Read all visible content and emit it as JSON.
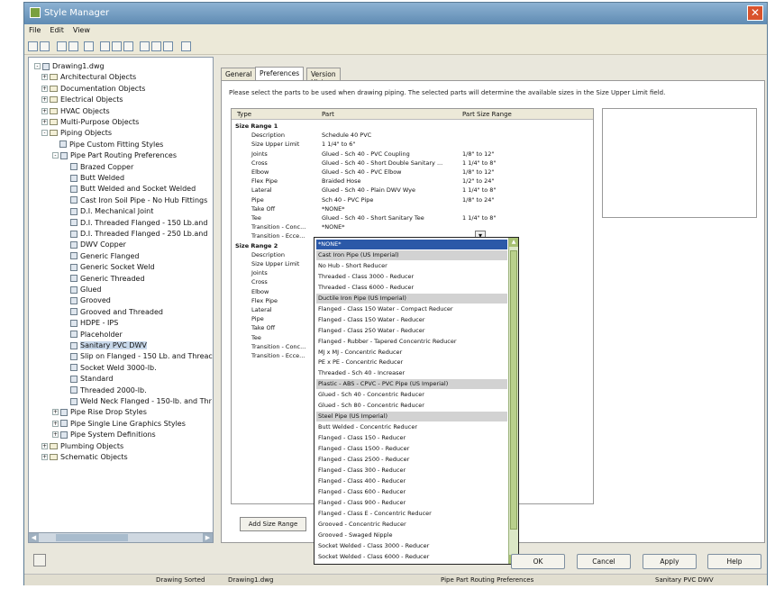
{
  "window": {
    "title": "Style Manager"
  },
  "menu": [
    "File",
    "Edit",
    "View"
  ],
  "tree": [
    {
      "label": "Drawing1.dwg",
      "x": 6,
      "icon": "drawing-icon",
      "ex": "-"
    },
    {
      "label": "Architectural Objects",
      "x": 14,
      "icon": "folder-icon",
      "ex": "+"
    },
    {
      "label": "Documentation Objects",
      "x": 14,
      "icon": "folder-icon",
      "ex": "+"
    },
    {
      "label": "Electrical Objects",
      "x": 14,
      "icon": "folder-icon",
      "ex": "+"
    },
    {
      "label": "HVAC Objects",
      "x": 14,
      "icon": "folder-icon",
      "ex": "+"
    },
    {
      "label": "Multi-Purpose Objects",
      "x": 14,
      "icon": "folder-icon",
      "ex": "+"
    },
    {
      "label": "Piping Objects",
      "x": 14,
      "icon": "folder-icon",
      "ex": "-"
    },
    {
      "label": "Pipe Custom Fitting Styles",
      "x": 34,
      "icon": "style-icon"
    },
    {
      "label": "Pipe Part Routing Preferences",
      "x": 26,
      "icon": "style-icon",
      "ex": "-"
    },
    {
      "label": "Brazed Copper",
      "x": 46,
      "icon": "style-icon"
    },
    {
      "label": "Butt Welded",
      "x": 46,
      "icon": "style-icon"
    },
    {
      "label": "Butt Welded and Socket Welded",
      "x": 46,
      "icon": "style-icon"
    },
    {
      "label": "Cast Iron Soil Pipe - No Hub Fittings",
      "x": 46,
      "icon": "style-icon"
    },
    {
      "label": "D.I. Mechanical Joint",
      "x": 46,
      "icon": "style-icon"
    },
    {
      "label": "D.I. Threaded Flanged - 150 Lb.and",
      "x": 46,
      "icon": "style-icon"
    },
    {
      "label": "D.I. Threaded Flanged - 250 Lb.and",
      "x": 46,
      "icon": "style-icon"
    },
    {
      "label": "DWV Copper",
      "x": 46,
      "icon": "style-icon"
    },
    {
      "label": "Generic Flanged",
      "x": 46,
      "icon": "style-icon"
    },
    {
      "label": "Generic Socket Weld",
      "x": 46,
      "icon": "style-icon"
    },
    {
      "label": "Generic Threaded",
      "x": 46,
      "icon": "style-icon"
    },
    {
      "label": "Glued",
      "x": 46,
      "icon": "style-icon"
    },
    {
      "label": "Grooved",
      "x": 46,
      "icon": "style-icon"
    },
    {
      "label": "Grooved and Threaded",
      "x": 46,
      "icon": "style-icon"
    },
    {
      "label": "HDPE - IPS",
      "x": 46,
      "icon": "style-icon"
    },
    {
      "label": "Placeholder",
      "x": 46,
      "icon": "style-icon"
    },
    {
      "label": "Sanitary PVC DWV",
      "x": 46,
      "icon": "style-icon",
      "sel": true
    },
    {
      "label": "Slip on Flanged - 150 Lb. and Threac",
      "x": 46,
      "icon": "style-icon"
    },
    {
      "label": "Socket Weld 3000-lb.",
      "x": 46,
      "icon": "style-icon"
    },
    {
      "label": "Standard",
      "x": 46,
      "icon": "style-icon"
    },
    {
      "label": "Threaded 2000-lb.",
      "x": 46,
      "icon": "style-icon"
    },
    {
      "label": "Weld Neck Flanged - 150-lb. and Thr",
      "x": 46,
      "icon": "style-icon"
    },
    {
      "label": "Pipe Rise Drop Styles",
      "x": 26,
      "icon": "style-icon",
      "ex": "+"
    },
    {
      "label": "Pipe Single Line Graphics Styles",
      "x": 26,
      "icon": "style-icon",
      "ex": "+"
    },
    {
      "label": "Pipe System Definitions",
      "x": 26,
      "icon": "style-icon",
      "ex": "+"
    },
    {
      "label": "Plumbing Objects",
      "x": 14,
      "icon": "folder-icon",
      "ex": "+"
    },
    {
      "label": "Schematic Objects",
      "x": 14,
      "icon": "folder-icon",
      "ex": "+"
    }
  ],
  "tabs": [
    "General",
    "Preferences",
    "Version History"
  ],
  "hint": "Please select the parts to be used when drawing piping. The selected parts will determine the available sizes in the Size Upper Limit field.",
  "grid_headers": [
    "Type",
    "Part",
    "Part Size Range"
  ],
  "grid_rows": [
    {
      "type": "Size Range 1",
      "part": "",
      "range": "",
      "group": true
    },
    {
      "type": "Description",
      "part": "Schedule 40 PVC",
      "range": ""
    },
    {
      "type": "Size Upper Limit",
      "part": "1 1/4\" to 6\"",
      "range": ""
    },
    {
      "type": "Joints",
      "part": "Glued - Sch 40 - PVC Coupling",
      "range": "1/8\" to 12\""
    },
    {
      "type": "Cross",
      "part": "Glued - Sch 40 - Short Double Sanitary ...",
      "range": "1 1/4\" to 8\""
    },
    {
      "type": "Elbow",
      "part": "Glued - Sch 40 - PVC Elbow",
      "range": "1/8\" to 12\""
    },
    {
      "type": "Flex Pipe",
      "part": "Braided Hose",
      "range": "1/2\" to 24\""
    },
    {
      "type": "Lateral",
      "part": "Glued - Sch 40 - Plain DWV Wye",
      "range": "1 1/4\" to 8\""
    },
    {
      "type": "Pipe",
      "part": "Sch 40 - PVC Pipe",
      "range": "1/8\" to 24\""
    },
    {
      "type": "Take Off",
      "part": "*NONE*",
      "range": ""
    },
    {
      "type": "Tee",
      "part": "Glued - Sch 40 - Short Sanitary Tee",
      "range": "1 1/4\" to 8\""
    },
    {
      "type": "Transition - Conc...",
      "part": "*NONE*",
      "range": ""
    },
    {
      "type": "Transition - Ecce...",
      "part": "",
      "range": ""
    },
    {
      "type": "Size Range 2",
      "part": "",
      "range": "",
      "group": true
    },
    {
      "type": "Description",
      "part": "",
      "range": ""
    },
    {
      "type": "Size Upper Limit",
      "part": "",
      "range": ""
    },
    {
      "type": "Joints",
      "part": "",
      "range": ""
    },
    {
      "type": "Cross",
      "part": "",
      "range": ""
    },
    {
      "type": "Elbow",
      "part": "",
      "range": ""
    },
    {
      "type": "Flex Pipe",
      "part": "",
      "range": ""
    },
    {
      "type": "Lateral",
      "part": "",
      "range": ""
    },
    {
      "type": "Pipe",
      "part": "",
      "range": ""
    },
    {
      "type": "Take Off",
      "part": "",
      "range": ""
    },
    {
      "type": "Tee",
      "part": "",
      "range": ""
    },
    {
      "type": "Transition - Conc...",
      "part": "",
      "range": ""
    },
    {
      "type": "Transition - Ecce...",
      "part": "",
      "range": ""
    }
  ],
  "dropdown_items": [
    {
      "label": "*NONE*",
      "kind": "hl"
    },
    {
      "label": "Cast Iron Pipe (US Imperial)",
      "kind": "hd"
    },
    {
      "label": "No Hub - Short Reducer"
    },
    {
      "label": "Threaded - Class 3000 - Reducer"
    },
    {
      "label": "Threaded - Class 6000 - Reducer"
    },
    {
      "label": "Ductile Iron Pipe (US Imperial)",
      "kind": "hd"
    },
    {
      "label": "Flanged - Class 150 Water - Compact Reducer"
    },
    {
      "label": "Flanged - Class 150 Water - Reducer"
    },
    {
      "label": "Flanged - Class 250 Water - Reducer"
    },
    {
      "label": "Flanged - Rubber - Tapered Concentric Reducer"
    },
    {
      "label": "MJ x MJ - Concentric Reducer"
    },
    {
      "label": "PE x PE - Concentric Reducer"
    },
    {
      "label": "Threaded - Sch 40 - Increaser"
    },
    {
      "label": "Plastic - ABS - CPVC - PVC Pipe (US Imperial)",
      "kind": "hd"
    },
    {
      "label": "Glued - Sch 40 - Concentric Reducer"
    },
    {
      "label": "Glued - Sch 80 - Concentric Reducer"
    },
    {
      "label": "Steel Pipe (US Imperial)",
      "kind": "hd"
    },
    {
      "label": "Butt Welded - Concentric Reducer"
    },
    {
      "label": "Flanged - Class 150 - Reducer"
    },
    {
      "label": "Flanged - Class 1500 - Reducer"
    },
    {
      "label": "Flanged - Class 2500 - Reducer"
    },
    {
      "label": "Flanged - Class 300 - Reducer"
    },
    {
      "label": "Flanged - Class 400 - Reducer"
    },
    {
      "label": "Flanged - Class 600 - Reducer"
    },
    {
      "label": "Flanged - Class 900 - Reducer"
    },
    {
      "label": "Flanged - Class E - Concentric Reducer"
    },
    {
      "label": "Grooved - Concentric Reducer"
    },
    {
      "label": "Grooved - Swaged Nipple"
    },
    {
      "label": "Socket Welded - Class 3000 - Reducer"
    },
    {
      "label": "Socket Welded - Class 6000 - Reducer"
    }
  ],
  "buttons": {
    "add_size_range": "Add Size Range",
    "ok": "OK",
    "cancel": "Cancel",
    "apply": "Apply",
    "help": "Help"
  },
  "status": {
    "sorted": "Drawing Sorted",
    "file": "Drawing1.dwg",
    "category": "Pipe Part Routing Preferences",
    "style": "Sanitary PVC DWV"
  }
}
